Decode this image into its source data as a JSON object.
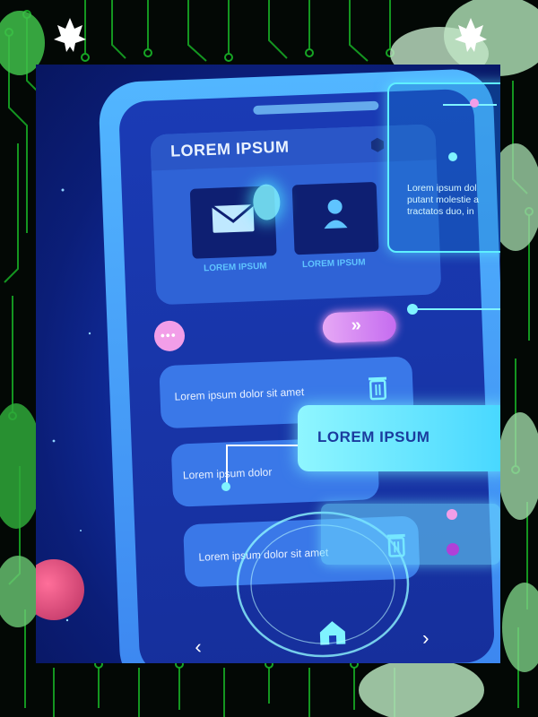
{
  "app_card": {
    "title": "LOREM IPSUM",
    "tiles": [
      {
        "label": "LOREM IPSUM",
        "icon": "mail-icon"
      },
      {
        "label": "LOREM IPSUM",
        "icon": "user-icon"
      }
    ]
  },
  "list_items": [
    {
      "text": "Lorem ipsum dolor sit amet",
      "icon": "trash-icon"
    },
    {
      "text": "Lorem ipsum dolor",
      "icon": null
    },
    {
      "text": "Lorem ipsum dolor sit amet",
      "icon": "trash-icon"
    }
  ],
  "overlay_panel": {
    "lines": [
      "Lorem ipsum dol",
      "putant molestie a",
      "tractatos duo, in"
    ]
  },
  "banner": {
    "label": "LOREM IPSUM"
  },
  "colors": {
    "accent_cyan": "#5ff0ff",
    "pink": "#f29ee8",
    "phone_blue": "#52b6ff",
    "circuit_green": "#17b326"
  }
}
